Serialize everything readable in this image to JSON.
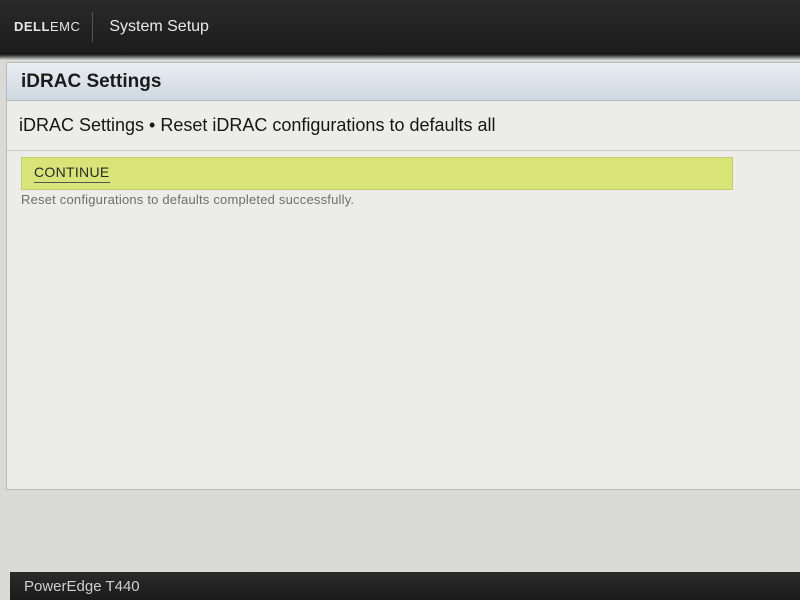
{
  "header": {
    "logo_dell": "DELL",
    "logo_emc": "EMC",
    "app_title": "System Setup"
  },
  "panel": {
    "title": "iDRAC Settings",
    "breadcrumb": "iDRAC Settings • Reset iDRAC configurations to defaults all",
    "continue_label": "CONTINUE",
    "status_message": "Reset configurations to defaults completed successfully."
  },
  "footer": {
    "model": "PowerEdge T440"
  },
  "colors": {
    "continue_bar": "#d8e477",
    "topbar": "#1c1c1c",
    "panel_header": "#cfd8e0"
  }
}
